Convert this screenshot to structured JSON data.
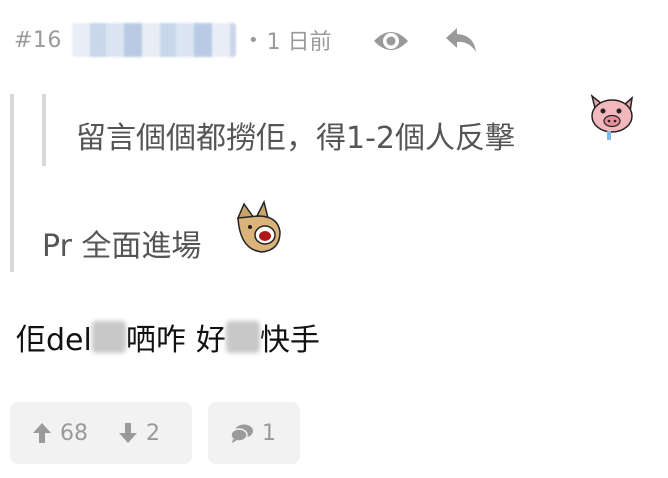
{
  "header": {
    "post_number": "#16",
    "separator": "•",
    "timestamp": "1 日前"
  },
  "quote": {
    "nested_text": "留言個個都撈佢，得1-2個人反擊",
    "outer_text": "Pr 全面進場"
  },
  "content": {
    "part1": "佢del",
    "part2": "哂咋",
    "part3": "好",
    "part4": "快手"
  },
  "actions": {
    "upvotes": "68",
    "downvotes": "2",
    "comments": "1"
  },
  "colors": {
    "meta_gray": "#9a9a9a",
    "quote_bar": "#d9d9d9",
    "button_bg": "#f2f2f2"
  }
}
